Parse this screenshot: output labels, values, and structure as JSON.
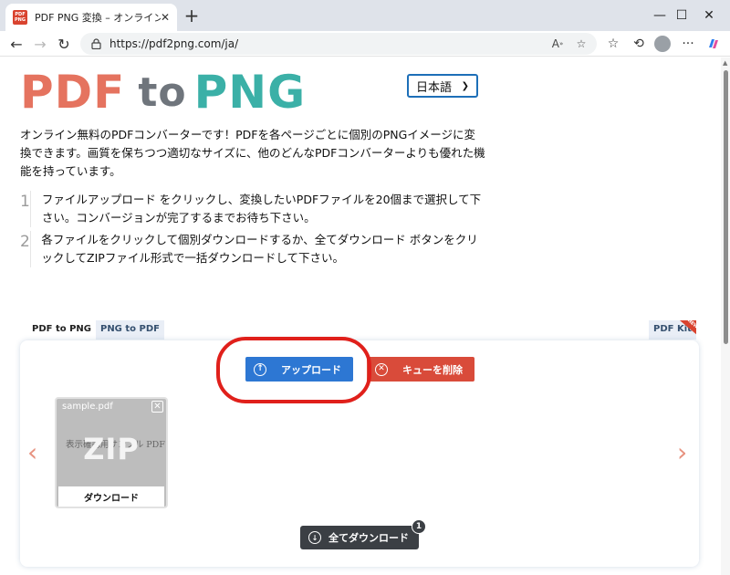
{
  "browser": {
    "tab": {
      "favicon_top": "PDF",
      "favicon_bottom": "PNG",
      "title": "PDF PNG 変換 – オンラインでPDFを"
    },
    "url": "https://pdf2png.com/ja/",
    "icons": {
      "back": "arrow-left-icon",
      "forward": "arrow-right-icon",
      "refresh": "refresh-icon",
      "lock": "lock-icon",
      "read_aloud": "read-aloud-icon",
      "favorite": "star-icon",
      "favorites_list": "favorites-icon",
      "history": "history-icon",
      "profile": "profile-icon",
      "more": "more-icon",
      "copilot": "copilot-icon"
    }
  },
  "header": {
    "logo": {
      "part1": "PDF",
      "part2": "to",
      "part3": "PNG"
    },
    "language": "日本語"
  },
  "intro": "オンライン無料のPDFコンバーターです！PDFを各ページごとに個別のPNGイメージに変換できます。画質を保ちつつ適切なサイズに、他のどんなPDFコンバーターよりも優れた機能を持っています。",
  "steps": [
    {
      "num": "1",
      "text": "ファイルアップロード をクリックし、変換したいPDFファイルを20個まで選択して下さい。コンバージョンが完了するまでお待ち下さい。"
    },
    {
      "num": "2",
      "text": "各ファイルをクリックして個別ダウンロードするか、全てダウンロード ボタンをクリックしてZIPファイル形式で一括ダウンロードして下さい。"
    }
  ],
  "tabs": {
    "active": "PDF to PNG",
    "other": "PNG to PDF",
    "kit": "PDF Kit",
    "kit_badge": "NEW"
  },
  "converter": {
    "upload_label": "アップロード",
    "clear_label": "キューを削除",
    "file": {
      "name": "sample.pdf",
      "preview_text": "表示確認用サンプル PDF",
      "overlay": "ZIP",
      "download_label": "ダウンロード"
    },
    "prev_arrow": "‹",
    "next_arrow": "›",
    "download_all_label": "全てダウンロード",
    "file_count": "1"
  },
  "colors": {
    "logo_pdf": "#e5735f",
    "logo_to": "#6f757c",
    "logo_png": "#3bb0a7",
    "upload_button": "#2d77d3",
    "clear_button": "#d94b3a",
    "annotation": "#e0201b"
  }
}
